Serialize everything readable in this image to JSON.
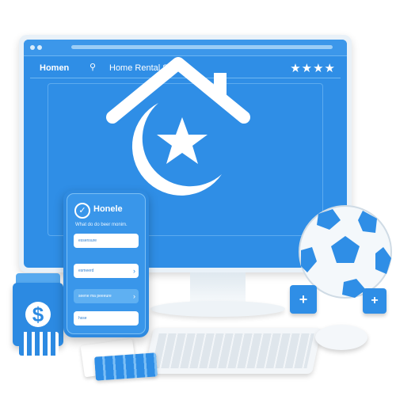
{
  "colors": {
    "screen_blue": "#2f8ee6",
    "accent_light": "#7bbef5",
    "white": "#ffffff"
  },
  "window": {
    "titlebar_text": "",
    "brand": "Homen",
    "title": "Home Rental System",
    "stars": "★★★★"
  },
  "logo": {
    "icon": "house-star-icon"
  },
  "phone": {
    "title": "Honele",
    "subtitle": "What do do beer monim.",
    "fields": [
      {
        "value": "essensure",
        "active": false
      },
      {
        "value": "esmeerd",
        "active": false
      },
      {
        "value": "seene ma peeeure",
        "active": true
      },
      {
        "value": "hsse",
        "active": false
      }
    ]
  },
  "money_box": {
    "symbol": "$"
  },
  "cubes": {
    "plus_symbol": "+"
  }
}
